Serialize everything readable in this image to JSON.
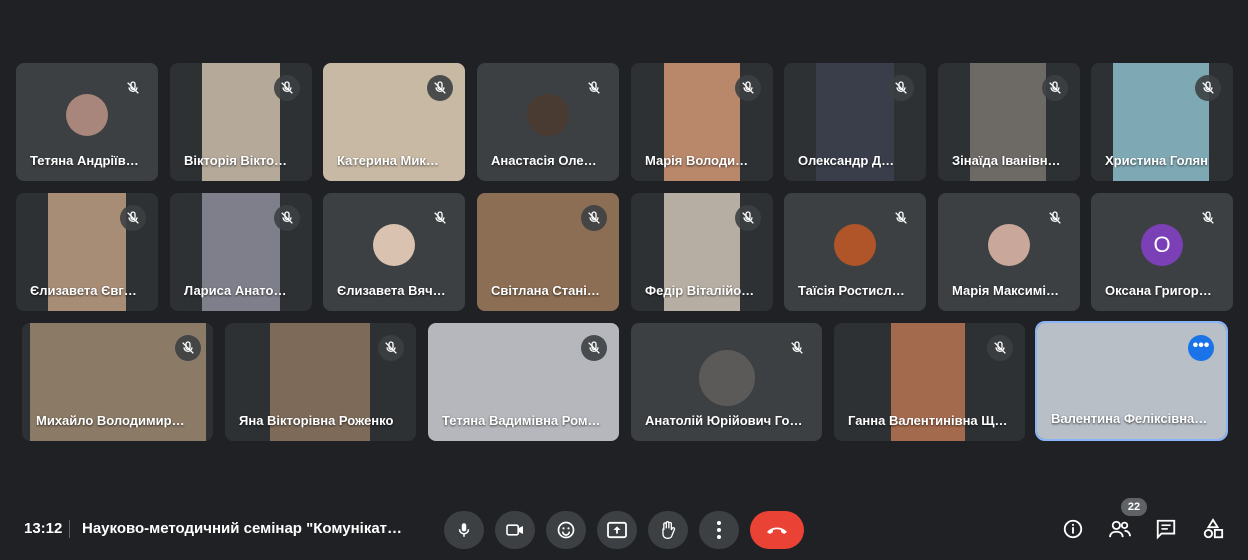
{
  "participants": [
    "Тетяна Андріїв…",
    "Вікторія Вікто…",
    "Катерина Мик…",
    "Анастасія Оле…",
    "Марія Володи…",
    "Олександр Д…",
    "Зінаїда Іванівн…",
    "Христина Голян",
    "Єлизавета Євг…",
    "Лариса Анато…",
    "Єлизавета Вяч…",
    "Світлана Стані…",
    "Федір Віталійо…",
    "Таїсія Ростисл…",
    "Марія Максимі…",
    "Оксана Григор…",
    "Михайло Володимир…",
    "Яна Вікторівна Роженко",
    "Тетяна Вадимівна Ром…",
    "Анатолій Юрійович Го…",
    "Ганна Валентинівна Щ…",
    "Валентина Феліксівна…"
  ],
  "avatar_letter": "О",
  "meeting": {
    "time": "13:12",
    "title": "Науково-методичний семінар \"Комунікат…"
  },
  "people_count": "22",
  "colors": {
    "end_call": "#ea4335",
    "more": "#1a73e8",
    "selected": "#8ab4f8"
  }
}
